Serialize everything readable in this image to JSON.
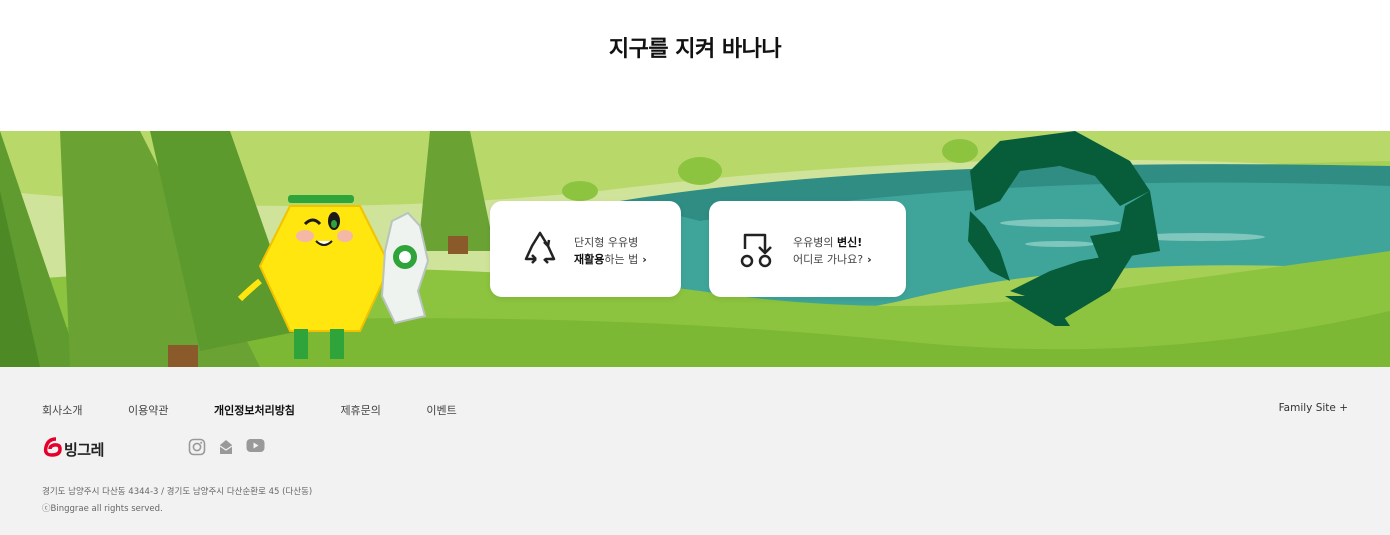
{
  "page": {
    "title": "지구를 지켜 바나나"
  },
  "cards": [
    {
      "line1": "단지형 우유병",
      "line2_bold": "재활용",
      "line2_rest": "하는 법",
      "icon": "recycle-icon"
    },
    {
      "line1_pre": "우유병의 ",
      "line1_bold": "변신!",
      "line2": "어디로 가나요?",
      "icon": "bottle-transform-icon"
    }
  ],
  "footer": {
    "nav": [
      "회사소개",
      "이용약관",
      "개인정보처리방침",
      "제휴문의",
      "이벤트"
    ],
    "family_site": "Family Site +",
    "logo_text": "빙그레",
    "social": [
      "instagram-icon",
      "mail-icon",
      "youtube-icon"
    ],
    "address": "경기도 남양주시 다산동 4344-3 / 경기도 남양주시 다산순환로 45 (다산동)",
    "copyright": "ⓒBinggrae all rights served."
  },
  "colors": {
    "grass": "#8cc43f",
    "water": "#3fa59a",
    "recycle": "#075c3a",
    "footer_bg": "#f2f2f2"
  }
}
